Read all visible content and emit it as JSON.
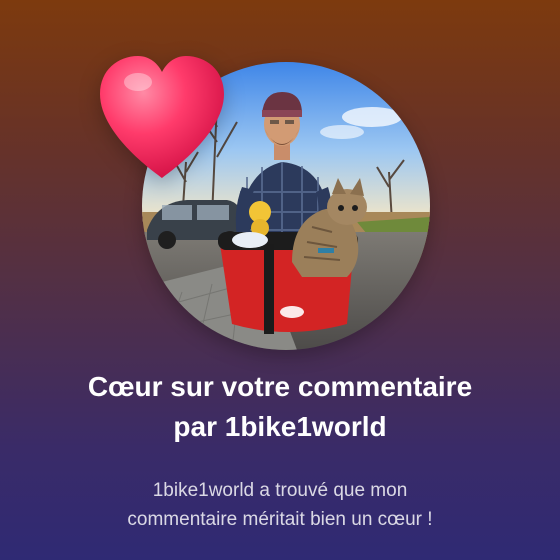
{
  "notification": {
    "title_line1": "Cœur sur votre commentaire",
    "title_line2": "par 1bike1world",
    "message_line1": "1bike1world a trouvé que mon",
    "message_line2": "commentaire méritait bien un cœur !"
  },
  "avatar": {
    "icon": "channel-avatar"
  },
  "badge": {
    "icon": "heart-icon",
    "color": "#ff3b6b"
  },
  "colors": {
    "background_top": "#7d3a0e",
    "background_bottom": "#2f2a74",
    "text_primary": "#ffffff",
    "text_secondary": "#d9d3e6"
  }
}
